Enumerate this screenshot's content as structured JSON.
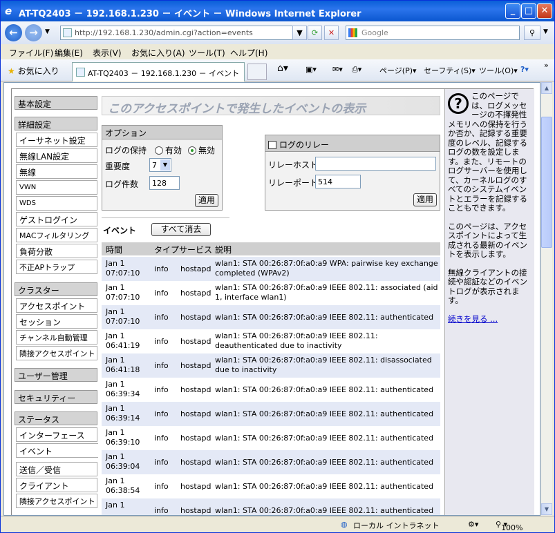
{
  "window": {
    "title": "AT-TQ2403 － 192.168.1.230 － イベント － Windows Internet Explorer"
  },
  "address": {
    "url": "http://192.168.1.230/admin.cgi?action=events"
  },
  "search": {
    "placeholder": "Google"
  },
  "menu": [
    "ファイル(F)",
    "編集(E)",
    "表示(V)",
    "お気に入り(A)",
    "ツール(T)",
    "ヘルプ(H)"
  ],
  "favorites": {
    "label": "お気に入り",
    "tab": "AT-TQ2403 － 192.168.1.230 － イベント",
    "page": "ページ(P)",
    "safety": "セーフティ(S)",
    "tools": "ツール(O)"
  },
  "sidebar": {
    "basic": "基本設定",
    "advanced": "詳細設定",
    "adv_items": [
      "イーサネット設定",
      "無線LAN設定",
      "無線",
      "VWN",
      "WDS",
      "ゲストログイン",
      "MACフィルタリング",
      "負荷分散",
      "不正APトラップ"
    ],
    "cluster": "クラスター",
    "cluster_items": [
      "アクセスポイント",
      "セッション",
      "チャンネル自動管理",
      "隣接アクセスポイント"
    ],
    "users": "ユーザー管理",
    "security": "セキュリティー",
    "status": "ステータス",
    "status_items": [
      "インターフェース",
      "イベント",
      "送信／受信",
      "クライアント",
      "隣接アクセスポイント"
    ]
  },
  "page": {
    "title": "このアクセスポイントで発生したイベントの表示"
  },
  "options": {
    "header": "オプション",
    "keep_label": "ログの保持",
    "opt_enabled": "有効",
    "opt_disabled": "無効",
    "severity_label": "重要度",
    "severity_value": "7",
    "count_label": "ログ件数",
    "count_value": "128",
    "apply": "適用"
  },
  "relay": {
    "header": "ログのリレー",
    "host_label": "リレーホスト",
    "host_value": "",
    "port_label": "リレーポート",
    "port_value": "514",
    "apply": "適用"
  },
  "events": {
    "label": "イベント",
    "clear": "すべて消去",
    "columns": [
      "時間",
      "タイプ",
      "サービス",
      "説明"
    ],
    "rows": [
      {
        "date": "Jan 1",
        "time": "07:07:10",
        "type": "info",
        "service": "hostapd",
        "desc": "wlan1: STA 00:26:87:0f:a0:a9 WPA: pairwise key exchange completed (WPAv2)"
      },
      {
        "date": "Jan 1",
        "time": "07:07:10",
        "type": "info",
        "service": "hostapd",
        "desc": "wlan1: STA 00:26:87:0f:a0:a9 IEEE 802.11: associated (aid 1, interface wlan1)"
      },
      {
        "date": "Jan 1",
        "time": "07:07:10",
        "type": "info",
        "service": "hostapd",
        "desc": "wlan1: STA 00:26:87:0f:a0:a9 IEEE 802.11: authenticated"
      },
      {
        "date": "Jan 1",
        "time": "06:41:19",
        "type": "info",
        "service": "hostapd",
        "desc": "wlan1: STA 00:26:87:0f:a0:a9 IEEE 802.11: deauthenticated due to inactivity"
      },
      {
        "date": "Jan 1",
        "time": "06:41:18",
        "type": "info",
        "service": "hostapd",
        "desc": "wlan1: STA 00:26:87:0f:a0:a9 IEEE 802.11: disassociated due to inactivity"
      },
      {
        "date": "Jan 1",
        "time": "06:39:34",
        "type": "info",
        "service": "hostapd",
        "desc": "wlan1: STA 00:26:87:0f:a0:a9 IEEE 802.11: authenticated"
      },
      {
        "date": "Jan 1",
        "time": "06:39:14",
        "type": "info",
        "service": "hostapd",
        "desc": "wlan1: STA 00:26:87:0f:a0:a9 IEEE 802.11: authenticated"
      },
      {
        "date": "Jan 1",
        "time": "06:39:10",
        "type": "info",
        "service": "hostapd",
        "desc": "wlan1: STA 00:26:87:0f:a0:a9 IEEE 802.11: authenticated"
      },
      {
        "date": "Jan 1",
        "time": "06:39:04",
        "type": "info",
        "service": "hostapd",
        "desc": "wlan1: STA 00:26:87:0f:a0:a9 IEEE 802.11: authenticated"
      },
      {
        "date": "Jan 1",
        "time": "06:38:54",
        "type": "info",
        "service": "hostapd",
        "desc": "wlan1: STA 00:26:87:0f:a0:a9 IEEE 802.11: authenticated"
      },
      {
        "date": "Jan 1",
        "time": "",
        "type": "info",
        "service": "hostapd",
        "desc": "wlan1: STA 00:26:87:0f:a0:a9 IEEE 802.11: authenticated"
      }
    ]
  },
  "help": {
    "p1": "このページでは、ログメッセージの不揮発性メモリへの保持を行うか否か、記録する重要度のレベル、記録するログの数を設定します。また、リモートのログサーバーを使用して、カーネルログのすべてのシステムイベントとエラーを記録することもできます。",
    "p2": "このページは、アクセスポイントによって生成される最新のイベントを表示します。",
    "p3": "無線クライアントの接続や認証などのイベントログが表示されます。",
    "more": "続きを見る ..."
  },
  "status": {
    "zone": "ローカル イントラネット",
    "zoom": "100%"
  }
}
